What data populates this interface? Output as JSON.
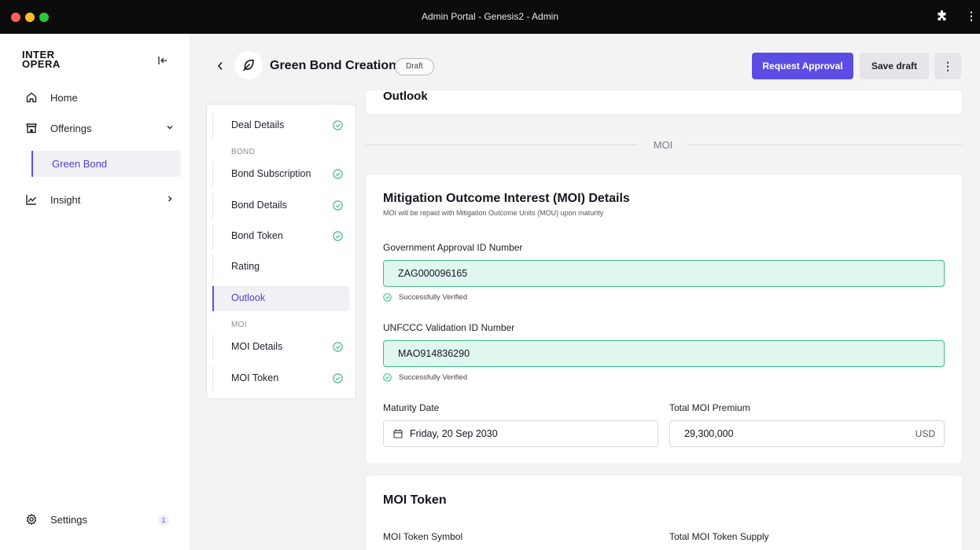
{
  "window": {
    "title": "Admin Portal - Genesis2 - Admin"
  },
  "sidebar": {
    "logo_line1": "INTER",
    "logo_line2": "OPERA",
    "items": [
      {
        "label": "Home",
        "icon": "home-icon"
      },
      {
        "label": "Offerings",
        "icon": "store-icon"
      },
      {
        "label": "Insight",
        "icon": "chart-line-icon"
      }
    ],
    "offerings_sub": "Green Bond",
    "settings_label": "Settings",
    "settings_badge": "1"
  },
  "header": {
    "title": "Green Bond Creation",
    "status": "Draft",
    "request_approval": "Request Approval",
    "save_draft": "Save draft",
    "more": "⋮"
  },
  "steps": {
    "deal_details": "Deal Details",
    "group_bond": "BOND",
    "bond_subscription": "Bond Subscription",
    "bond_details": "Bond Details",
    "bond_token": "Bond Token",
    "rating": "Rating",
    "outlook": "Outlook",
    "group_moi": "MOI",
    "moi_details": "MOI Details",
    "moi_token": "MOI Token"
  },
  "content": {
    "outlook_title": "Outlook",
    "section_divider": "MOI",
    "moi_card": {
      "title": "Mitigation Outcome Interest (MOI) Details",
      "subtitle": "MOI will be repaid with Mitigation Outcome Units (MOU) upon maturity",
      "gov_label": "Government Approval ID Number",
      "gov_value": "ZAG000096165",
      "verified_text": "Successfully Verified",
      "unfccc_label": "UNFCCC Validation ID Number",
      "unfccc_value": "MAO914836290",
      "maturity_label": "Maturity Date",
      "maturity_value": "Friday, 20 Sep 2030",
      "premium_label": "Total MOI Premium",
      "premium_value": "29,300,000",
      "premium_currency": "USD"
    },
    "token_card": {
      "title": "MOI Token",
      "symbol_label": "MOI Token Symbol",
      "supply_label": "Total MOI Token Supply"
    }
  },
  "colors": {
    "primary": "#5b4de3",
    "success": "#3dbd8a",
    "verified_bg": "#dff7ee"
  }
}
